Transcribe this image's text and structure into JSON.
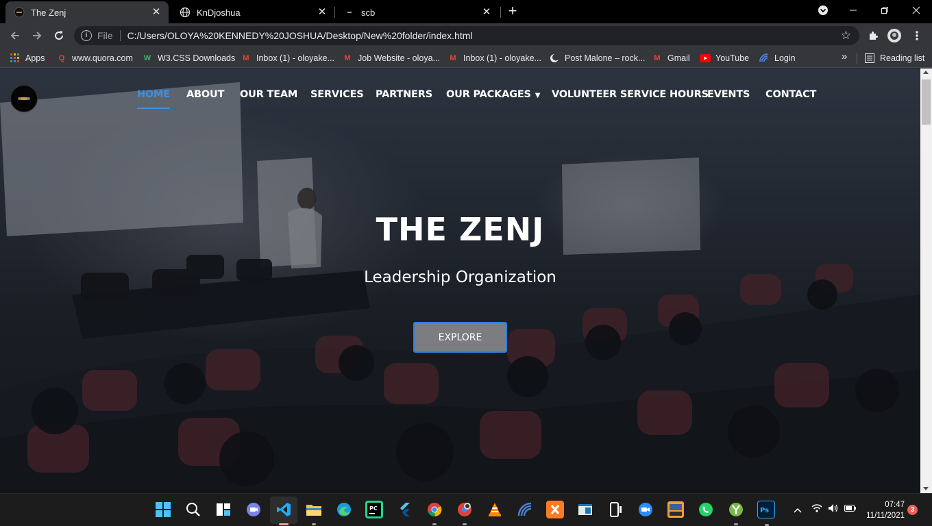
{
  "browser": {
    "tabs": [
      {
        "title": "The Zenj",
        "active": true
      },
      {
        "title": "KnDjoshua",
        "active": false
      },
      {
        "title": "scb",
        "active": false
      }
    ],
    "address": {
      "scheme_label": "File",
      "url": "C:/Users/OLOYA%20KENNEDY%20JOSHUA/Desktop/New%20folder/index.html"
    },
    "bookmarks": [
      {
        "label": "Apps",
        "icon": "apps-grid-icon"
      },
      {
        "label": "www.quora.com",
        "icon": "quora-icon"
      },
      {
        "label": "W3.CSS Downloads",
        "icon": "w3schools-icon"
      },
      {
        "label": "Inbox (1) - oloyake...",
        "icon": "gmail-icon"
      },
      {
        "label": "Job Website - oloya...",
        "icon": "gmail-icon"
      },
      {
        "label": "Inbox (1) - oloyake...",
        "icon": "gmail-icon"
      },
      {
        "label": "Post Malone – rock...",
        "icon": "moon-icon"
      },
      {
        "label": "Gmail",
        "icon": "gmail-icon"
      },
      {
        "label": "YouTube",
        "icon": "youtube-icon"
      },
      {
        "label": "Login",
        "icon": "login-icon"
      }
    ],
    "reading_list": "Reading list"
  },
  "site": {
    "nav": [
      {
        "label": "HOME",
        "active": true
      },
      {
        "label": "ABOUT"
      },
      {
        "label": "OUR TEAM"
      },
      {
        "label": "SERVICES"
      },
      {
        "label": "PARTNERS"
      },
      {
        "label": "OUR PACKAGES",
        "dropdown": true
      },
      {
        "label": "VOLUNTEER SERVICE HOURS"
      },
      {
        "label": "EVENTS"
      },
      {
        "label": "CONTACT"
      }
    ],
    "hero": {
      "title": "THE ZENJ",
      "subtitle": "Leadership Organization",
      "button": "EXPLORE"
    },
    "colors": {
      "accent": "#3a8fe6",
      "button_bg": "#7b7d80"
    }
  },
  "taskbar": {
    "apps": [
      "windows-start-icon",
      "search-icon",
      "task-view-icon",
      "teams-chat-icon",
      "vscode-icon",
      "file-explorer-icon",
      "edge-icon",
      "pycharm-icon",
      "flutter-icon",
      "chrome-icon",
      "chrome-profile-icon",
      "vlc-icon",
      "wifi-app-icon",
      "xampp-icon",
      "app-window-icon",
      "phone-link-icon",
      "zoom-icon",
      "typing-practice-icon",
      "whatsapp-icon",
      "app-y-icon",
      "photoshop-icon"
    ],
    "time": "07:47",
    "date": "11/11/2021",
    "notifications": "3"
  }
}
